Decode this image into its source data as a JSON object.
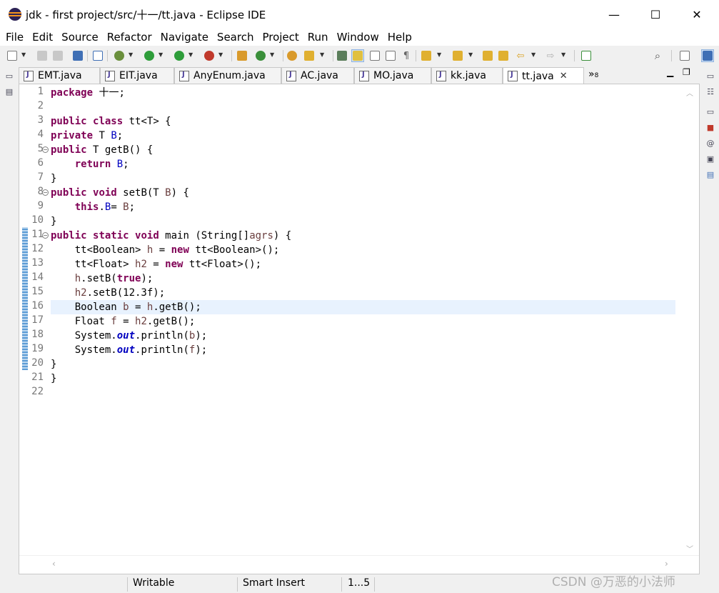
{
  "window": {
    "title": "jdk - first project/src/十一/tt.java - Eclipse IDE",
    "minimize_glyph": "—",
    "maximize_glyph": "☐",
    "close_glyph": "✕"
  },
  "menu": [
    "File",
    "Edit",
    "Source",
    "Refactor",
    "Navigate",
    "Search",
    "Project",
    "Run",
    "Window",
    "Help"
  ],
  "tabs": [
    {
      "label": "EMT.java",
      "active": false
    },
    {
      "label": "EIT.java",
      "active": false
    },
    {
      "label": "AnyEnum.java",
      "active": false
    },
    {
      "label": "AC.java",
      "active": false
    },
    {
      "label": "MO.java",
      "active": false
    },
    {
      "label": "kk.java",
      "active": false
    },
    {
      "label": "tt.java",
      "active": true
    }
  ],
  "tab_overflow": "»",
  "tab_overflow_count": "8",
  "editor": {
    "file": "tt.java",
    "current_line": 16,
    "line_numbers": [
      "1",
      "2",
      "3",
      "4",
      "5",
      "6",
      "7",
      "8",
      "9",
      "10",
      "11",
      "12",
      "13",
      "14",
      "15",
      "16",
      "17",
      "18",
      "19",
      "20",
      "21",
      "22"
    ]
  },
  "status": {
    "writable": "Writable",
    "insert_mode": "Smart Insert",
    "position": "1...5"
  },
  "watermark": "CSDN @万恶的小法师",
  "colors": {
    "keyword": "#7f0055",
    "field": "#0000c0",
    "local_var": "#6a3e3e",
    "current_line": "#e8f2fe"
  }
}
